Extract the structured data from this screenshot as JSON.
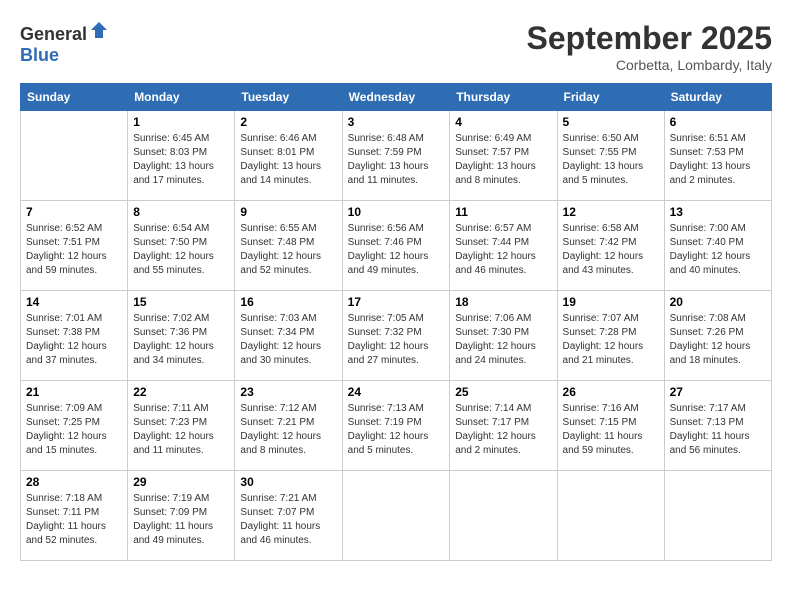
{
  "logo": {
    "general": "General",
    "blue": "Blue"
  },
  "header": {
    "month_title": "September 2025",
    "subtitle": "Corbetta, Lombardy, Italy"
  },
  "days_of_week": [
    "Sunday",
    "Monday",
    "Tuesday",
    "Wednesday",
    "Thursday",
    "Friday",
    "Saturday"
  ],
  "weeks": [
    [
      {
        "day": "",
        "info": ""
      },
      {
        "day": "1",
        "info": "Sunrise: 6:45 AM\nSunset: 8:03 PM\nDaylight: 13 hours\nand 17 minutes."
      },
      {
        "day": "2",
        "info": "Sunrise: 6:46 AM\nSunset: 8:01 PM\nDaylight: 13 hours\nand 14 minutes."
      },
      {
        "day": "3",
        "info": "Sunrise: 6:48 AM\nSunset: 7:59 PM\nDaylight: 13 hours\nand 11 minutes."
      },
      {
        "day": "4",
        "info": "Sunrise: 6:49 AM\nSunset: 7:57 PM\nDaylight: 13 hours\nand 8 minutes."
      },
      {
        "day": "5",
        "info": "Sunrise: 6:50 AM\nSunset: 7:55 PM\nDaylight: 13 hours\nand 5 minutes."
      },
      {
        "day": "6",
        "info": "Sunrise: 6:51 AM\nSunset: 7:53 PM\nDaylight: 13 hours\nand 2 minutes."
      }
    ],
    [
      {
        "day": "7",
        "info": "Sunrise: 6:52 AM\nSunset: 7:51 PM\nDaylight: 12 hours\nand 59 minutes."
      },
      {
        "day": "8",
        "info": "Sunrise: 6:54 AM\nSunset: 7:50 PM\nDaylight: 12 hours\nand 55 minutes."
      },
      {
        "day": "9",
        "info": "Sunrise: 6:55 AM\nSunset: 7:48 PM\nDaylight: 12 hours\nand 52 minutes."
      },
      {
        "day": "10",
        "info": "Sunrise: 6:56 AM\nSunset: 7:46 PM\nDaylight: 12 hours\nand 49 minutes."
      },
      {
        "day": "11",
        "info": "Sunrise: 6:57 AM\nSunset: 7:44 PM\nDaylight: 12 hours\nand 46 minutes."
      },
      {
        "day": "12",
        "info": "Sunrise: 6:58 AM\nSunset: 7:42 PM\nDaylight: 12 hours\nand 43 minutes."
      },
      {
        "day": "13",
        "info": "Sunrise: 7:00 AM\nSunset: 7:40 PM\nDaylight: 12 hours\nand 40 minutes."
      }
    ],
    [
      {
        "day": "14",
        "info": "Sunrise: 7:01 AM\nSunset: 7:38 PM\nDaylight: 12 hours\nand 37 minutes."
      },
      {
        "day": "15",
        "info": "Sunrise: 7:02 AM\nSunset: 7:36 PM\nDaylight: 12 hours\nand 34 minutes."
      },
      {
        "day": "16",
        "info": "Sunrise: 7:03 AM\nSunset: 7:34 PM\nDaylight: 12 hours\nand 30 minutes."
      },
      {
        "day": "17",
        "info": "Sunrise: 7:05 AM\nSunset: 7:32 PM\nDaylight: 12 hours\nand 27 minutes."
      },
      {
        "day": "18",
        "info": "Sunrise: 7:06 AM\nSunset: 7:30 PM\nDaylight: 12 hours\nand 24 minutes."
      },
      {
        "day": "19",
        "info": "Sunrise: 7:07 AM\nSunset: 7:28 PM\nDaylight: 12 hours\nand 21 minutes."
      },
      {
        "day": "20",
        "info": "Sunrise: 7:08 AM\nSunset: 7:26 PM\nDaylight: 12 hours\nand 18 minutes."
      }
    ],
    [
      {
        "day": "21",
        "info": "Sunrise: 7:09 AM\nSunset: 7:25 PM\nDaylight: 12 hours\nand 15 minutes."
      },
      {
        "day": "22",
        "info": "Sunrise: 7:11 AM\nSunset: 7:23 PM\nDaylight: 12 hours\nand 11 minutes."
      },
      {
        "day": "23",
        "info": "Sunrise: 7:12 AM\nSunset: 7:21 PM\nDaylight: 12 hours\nand 8 minutes."
      },
      {
        "day": "24",
        "info": "Sunrise: 7:13 AM\nSunset: 7:19 PM\nDaylight: 12 hours\nand 5 minutes."
      },
      {
        "day": "25",
        "info": "Sunrise: 7:14 AM\nSunset: 7:17 PM\nDaylight: 12 hours\nand 2 minutes."
      },
      {
        "day": "26",
        "info": "Sunrise: 7:16 AM\nSunset: 7:15 PM\nDaylight: 11 hours\nand 59 minutes."
      },
      {
        "day": "27",
        "info": "Sunrise: 7:17 AM\nSunset: 7:13 PM\nDaylight: 11 hours\nand 56 minutes."
      }
    ],
    [
      {
        "day": "28",
        "info": "Sunrise: 7:18 AM\nSunset: 7:11 PM\nDaylight: 11 hours\nand 52 minutes."
      },
      {
        "day": "29",
        "info": "Sunrise: 7:19 AM\nSunset: 7:09 PM\nDaylight: 11 hours\nand 49 minutes."
      },
      {
        "day": "30",
        "info": "Sunrise: 7:21 AM\nSunset: 7:07 PM\nDaylight: 11 hours\nand 46 minutes."
      },
      {
        "day": "",
        "info": ""
      },
      {
        "day": "",
        "info": ""
      },
      {
        "day": "",
        "info": ""
      },
      {
        "day": "",
        "info": ""
      }
    ]
  ]
}
